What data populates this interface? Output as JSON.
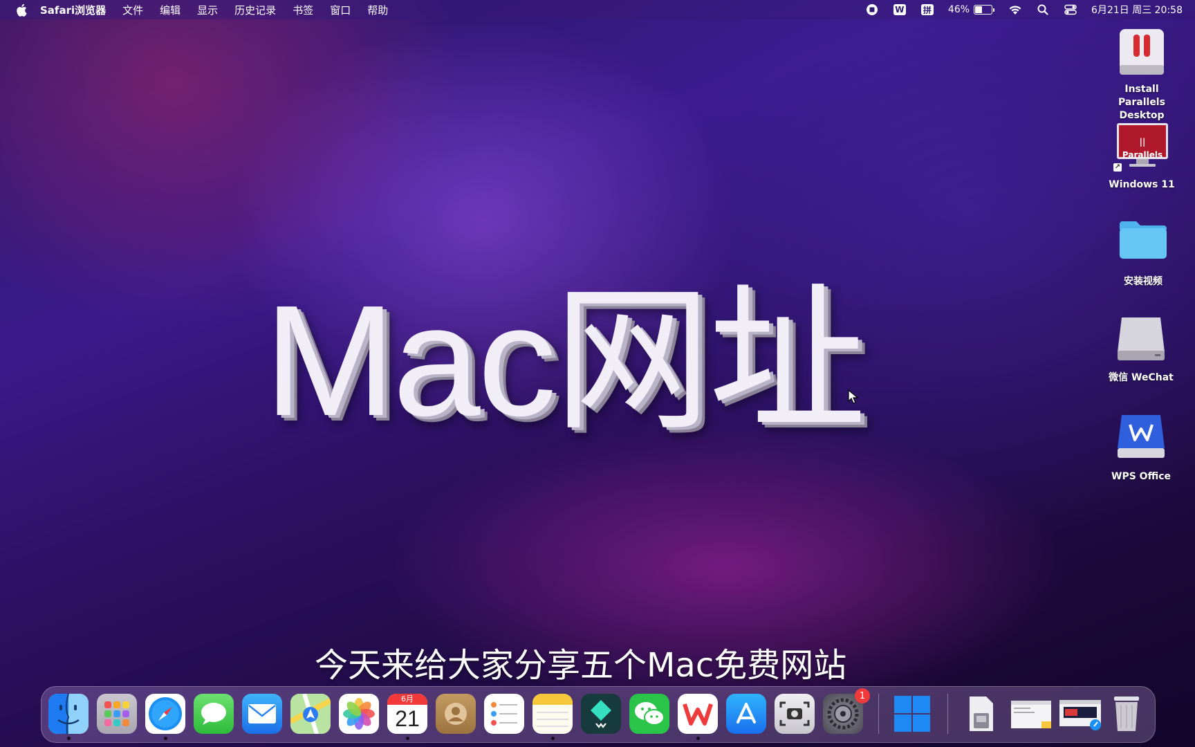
{
  "menubar": {
    "app_name": "Safari浏览器",
    "menus": [
      "文件",
      "编辑",
      "显示",
      "历史记录",
      "书签",
      "窗口",
      "帮助"
    ],
    "status_icons": [
      "screen-record-icon",
      "wps-icon",
      "input-method-icon"
    ],
    "input_method": "拼",
    "wps_glyph": "W",
    "battery_percent": "46%",
    "battery_level": 0.46,
    "datetime": "6月21日 周三 20:58"
  },
  "desktop_icons": [
    {
      "label": "Install Parallels Desktop",
      "icon": "parallels-installer-icon"
    },
    {
      "label": "Windows 11",
      "icon": "parallels-vm-icon",
      "inner_text": "|| Parallels"
    },
    {
      "label": "安装视频",
      "icon": "folder-icon"
    },
    {
      "label": "微信 WeChat",
      "icon": "disk-image-icon"
    },
    {
      "label": "WPS Office",
      "icon": "wps-disk-image-icon"
    }
  ],
  "overlay": {
    "title": "Mac网址",
    "subtitle": "今天来给大家分享五个Mac免费网站"
  },
  "dock": {
    "apps": [
      {
        "name": "Finder",
        "icon": "finder-icon",
        "running": true
      },
      {
        "name": "Launchpad",
        "icon": "launchpad-icon",
        "running": false
      },
      {
        "name": "Safari",
        "icon": "safari-icon",
        "running": true
      },
      {
        "name": "Messages",
        "icon": "messages-icon",
        "running": false
      },
      {
        "name": "Mail",
        "icon": "mail-icon",
        "running": false
      },
      {
        "name": "Maps",
        "icon": "maps-icon",
        "running": false
      },
      {
        "name": "Photos",
        "icon": "photos-icon",
        "running": false
      },
      {
        "name": "Calendar",
        "icon": "calendar-icon",
        "running": true,
        "month": "6月",
        "day": "21"
      },
      {
        "name": "Contacts",
        "icon": "contacts-icon",
        "running": false
      },
      {
        "name": "Reminders",
        "icon": "reminders-icon",
        "running": false
      },
      {
        "name": "Notes",
        "icon": "notes-icon",
        "running": true
      },
      {
        "name": "Filmora",
        "icon": "filmora-icon",
        "running": false
      },
      {
        "name": "WeChat",
        "icon": "wechat-icon",
        "running": false
      },
      {
        "name": "WPS Office",
        "icon": "wps-icon",
        "running": true
      },
      {
        "name": "App Store",
        "icon": "app-store-icon",
        "running": false
      },
      {
        "name": "Screenshot",
        "icon": "screenshot-icon",
        "running": false
      },
      {
        "name": "System Settings",
        "icon": "settings-icon",
        "running": false,
        "badge": "1"
      },
      {
        "name": "Windows 11",
        "icon": "windows-icon",
        "running": false
      },
      {
        "name": "Downloads",
        "icon": "downloads-stack-icon",
        "running": false
      },
      {
        "name": "Documents",
        "icon": "documents-stack-icon",
        "running": false
      },
      {
        "name": "Safari Window",
        "icon": "minimized-window-icon",
        "running": false
      },
      {
        "name": "Trash",
        "icon": "trash-icon",
        "running": false
      }
    ]
  }
}
